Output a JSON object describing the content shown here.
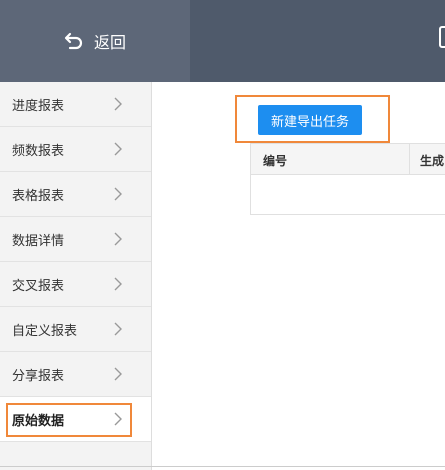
{
  "header": {
    "back_label": "返回"
  },
  "sidebar": {
    "items": [
      {
        "label": "进度报表"
      },
      {
        "label": "频数报表"
      },
      {
        "label": "表格报表"
      },
      {
        "label": "数据详情"
      },
      {
        "label": "交叉报表"
      },
      {
        "label": "自定义报表"
      },
      {
        "label": "分享报表"
      },
      {
        "label": "原始数据"
      }
    ],
    "active_index": 7
  },
  "main": {
    "new_task_label": "新建导出任务",
    "table": {
      "columns": [
        "编号",
        "生成"
      ]
    }
  },
  "colors": {
    "header": "#4f5a6b",
    "button": "#1d8ef0",
    "highlight": "#f0883a"
  }
}
